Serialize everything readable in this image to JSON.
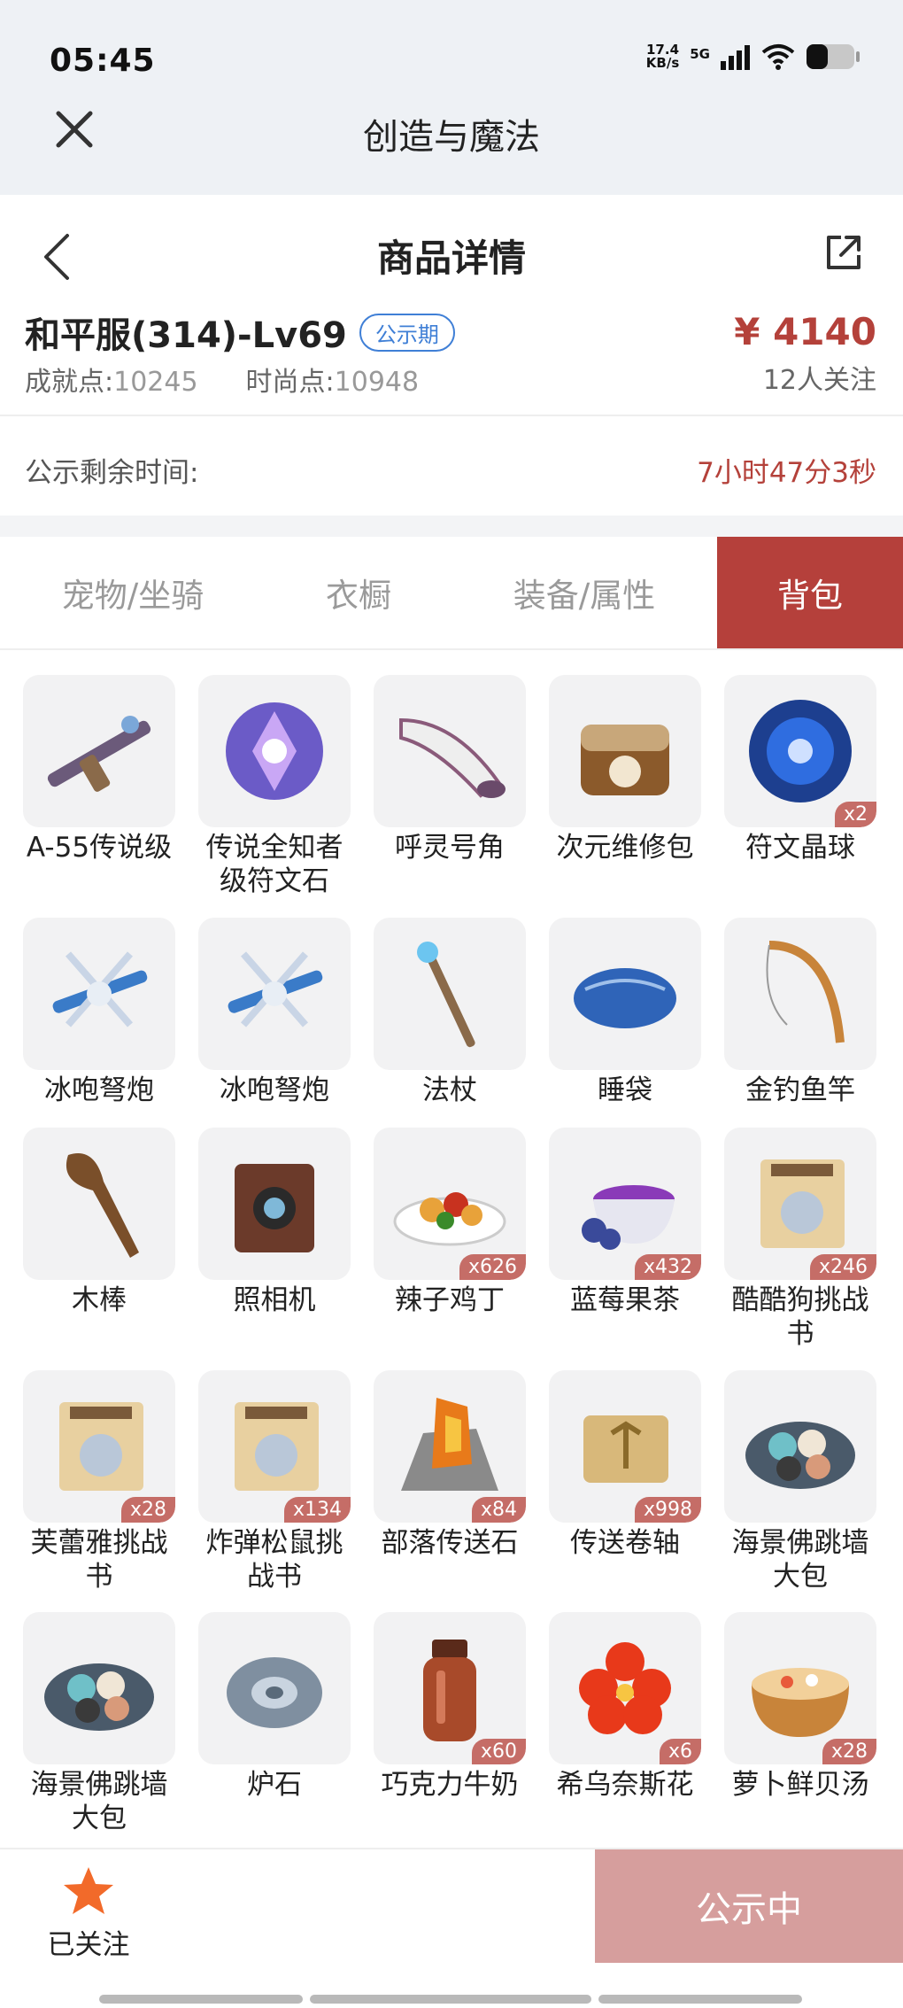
{
  "status_bar": {
    "time": "05:45",
    "net_speed_value": "17.4",
    "net_speed_unit": "KB/s",
    "network": "5G"
  },
  "app_header": {
    "title": "创造与魔法"
  },
  "detail_nav": {
    "title": "商品详情"
  },
  "item": {
    "name": "和平服(314)-Lv69",
    "badge": "公示期",
    "achievement_label": "成就点:",
    "achievement_value": "10245",
    "fashion_label": "时尚点:",
    "fashion_value": "10948",
    "price": "¥ 4140",
    "followers": "12人关注"
  },
  "countdown": {
    "label": "公示剩余时间:",
    "value": "7小时47分3秒"
  },
  "tabs": [
    {
      "label": "宠物/坐骑"
    },
    {
      "label": "衣橱"
    },
    {
      "label": "装备/属性"
    },
    {
      "label": "背包"
    }
  ],
  "inventory": [
    {
      "name": "A-55传说级",
      "qty": "",
      "icon": "rifle-icon"
    },
    {
      "name": "传说全知者级符文石",
      "qty": "",
      "icon": "rune-stone-icon"
    },
    {
      "name": "呼灵号角",
      "qty": "",
      "icon": "horn-icon"
    },
    {
      "name": "次元维修包",
      "qty": "",
      "icon": "repair-bag-icon"
    },
    {
      "name": "符文晶球",
      "qty": "x2",
      "icon": "rune-orb-icon"
    },
    {
      "name": "冰咆弩炮",
      "qty": "",
      "icon": "crossbow-icon"
    },
    {
      "name": "冰咆弩炮",
      "qty": "",
      "icon": "crossbow-icon"
    },
    {
      "name": "法杖",
      "qty": "",
      "icon": "staff-icon"
    },
    {
      "name": "睡袋",
      "qty": "",
      "icon": "sleeping-bag-icon"
    },
    {
      "name": "金钓鱼竿",
      "qty": "",
      "icon": "fishing-rod-icon"
    },
    {
      "name": "木棒",
      "qty": "",
      "icon": "club-icon"
    },
    {
      "name": "照相机",
      "qty": "",
      "icon": "camera-icon"
    },
    {
      "name": "辣子鸡丁",
      "qty": "x626",
      "icon": "dish-icon"
    },
    {
      "name": "蓝莓果茶",
      "qty": "x432",
      "icon": "tea-icon"
    },
    {
      "name": "酷酷狗挑战书",
      "qty": "x246",
      "icon": "wanted-scroll-icon"
    },
    {
      "name": "芙蕾雅挑战书",
      "qty": "x28",
      "icon": "wanted-scroll-icon"
    },
    {
      "name": "炸弹松鼠挑战书",
      "qty": "x134",
      "icon": "wanted-scroll-icon"
    },
    {
      "name": "部落传送石",
      "qty": "x84",
      "icon": "teleport-stone-icon"
    },
    {
      "name": "传送卷轴",
      "qty": "x998",
      "icon": "scroll-icon"
    },
    {
      "name": "海景佛跳墙大包",
      "qty": "",
      "icon": "bun-plate-icon"
    },
    {
      "name": "海景佛跳墙大包",
      "qty": "",
      "icon": "bun-plate-icon"
    },
    {
      "name": "炉石",
      "qty": "",
      "icon": "hearthstone-icon"
    },
    {
      "name": "巧克力牛奶",
      "qty": "x60",
      "icon": "milk-bottle-icon"
    },
    {
      "name": "希乌奈斯花",
      "qty": "x6",
      "icon": "flower-icon"
    },
    {
      "name": "萝卜鲜贝汤",
      "qty": "x28",
      "icon": "soup-icon"
    }
  ],
  "bottom_bar": {
    "follow_label": "已关注",
    "status_label": "公示中"
  },
  "colors": {
    "accent": "#b5403b",
    "price": "#b4413a",
    "badge": "#3f7fd6",
    "status_button": "#d69e9d",
    "star": "#f26a2a"
  }
}
